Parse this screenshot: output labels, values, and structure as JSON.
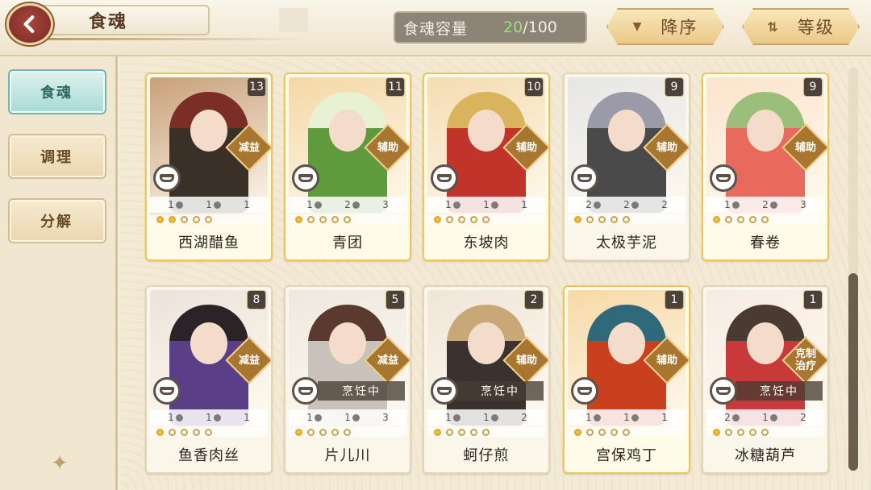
{
  "header": {
    "title": "食魂",
    "capacity": {
      "label": "食魂容量",
      "current": "20",
      "separator": "/",
      "max": "100"
    },
    "sort_label": "降序",
    "level_label": "等级"
  },
  "sidebar": {
    "items": [
      {
        "label": "食魂",
        "active": true
      },
      {
        "label": "调理",
        "active": false
      },
      {
        "label": "分解",
        "active": false
      }
    ]
  },
  "cards": [
    {
      "name": "西湖醋鱼",
      "level": "13",
      "role": "减益",
      "status": "",
      "stats": [
        "1",
        "1",
        "1"
      ],
      "stars": 2,
      "gold": true,
      "palette": [
        "#c9a07a",
        "#3b3028",
        "#7a2e26"
      ]
    },
    {
      "name": "青团",
      "level": "11",
      "role": "辅助",
      "status": "",
      "stats": [
        "1",
        "2",
        "3"
      ],
      "stars": 1,
      "gold": true,
      "palette": [
        "#f4d8a6",
        "#5f9a3c",
        "#e8f2d2"
      ]
    },
    {
      "name": "东坡肉",
      "level": "10",
      "role": "辅助",
      "status": "",
      "stats": [
        "1",
        "1",
        "1"
      ],
      "stars": 1,
      "gold": true,
      "palette": [
        "#f4dcb2",
        "#c0342a",
        "#d9b45c"
      ]
    },
    {
      "name": "太极芋泥",
      "level": "9",
      "role": "辅助",
      "status": "",
      "stats": [
        "2",
        "2",
        "2"
      ],
      "stars": 1,
      "gold": false,
      "palette": [
        "#e6e6e6",
        "#4a4a4a",
        "#9a9aa8"
      ]
    },
    {
      "name": "春卷",
      "level": "9",
      "role": "辅助",
      "status": "",
      "stats": [
        "1",
        "2",
        "3"
      ],
      "stars": 1,
      "gold": true,
      "palette": [
        "#fbe4cc",
        "#e86a5c",
        "#9bbe7a"
      ]
    },
    {
      "name": "鱼香肉丝",
      "level": "8",
      "role": "减益",
      "status": "",
      "stats": [
        "1",
        "1",
        "1"
      ],
      "stars": 1,
      "gold": false,
      "palette": [
        "#ece4dc",
        "#5a3e86",
        "#2a2428"
      ]
    },
    {
      "name": "片儿川",
      "level": "5",
      "role": "减益",
      "status": "烹饪中",
      "stats": [
        "1",
        "1",
        "3"
      ],
      "stars": 1,
      "gold": false,
      "palette": [
        "#eee8e0",
        "#c9c2ba",
        "#5a3a2e"
      ]
    },
    {
      "name": "蚵仔煎",
      "level": "2",
      "role": "辅助",
      "status": "烹饪中",
      "stats": [
        "1",
        "1",
        "2"
      ],
      "stars": 1,
      "gold": false,
      "palette": [
        "#efe6d8",
        "#3b3230",
        "#c9a878"
      ]
    },
    {
      "name": "宫保鸡丁",
      "level": "1",
      "role": "辅助",
      "status": "",
      "stats": [
        "1",
        "1",
        "1"
      ],
      "stars": 1,
      "gold": true,
      "palette": [
        "#f7d9a6",
        "#c8401e",
        "#2e6a7a"
      ]
    },
    {
      "name": "冰糖葫芦",
      "level": "1",
      "role": "克制\n治疗",
      "status": "烹饪中",
      "stats": [
        "2",
        "1",
        "2"
      ],
      "stars": 1,
      "gold": false,
      "palette": [
        "#f7ece4",
        "#c83a3a",
        "#4a3a32"
      ]
    }
  ]
}
